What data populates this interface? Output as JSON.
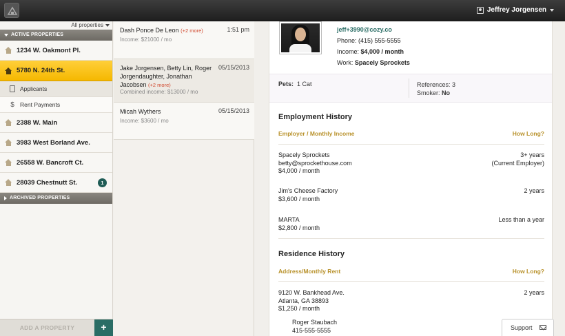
{
  "header": {
    "user_name": "Jeffrey Jorgensen"
  },
  "sidebar": {
    "filter_label": "All properties",
    "active_section": "ACTIVE PROPERTIES",
    "archived_section": "ARCHIVED PROPERTIES",
    "properties": [
      {
        "label": "1234 W. Oakmont Pl."
      },
      {
        "label": "5780 N. 24th St."
      },
      {
        "label": "2388 W. Main"
      },
      {
        "label": "3983 West Borland Ave."
      },
      {
        "label": "26558 W. Bancroft Ct."
      },
      {
        "label": "28039 Chestnutt St.",
        "badge": "1"
      }
    ],
    "subitems": [
      {
        "label": "Applicants"
      },
      {
        "label": "Rent Payments"
      }
    ],
    "add_property_label": "ADD A PROPERTY",
    "plus_label": "+"
  },
  "applicants": [
    {
      "name": "Dash Ponce De Leon",
      "more": "(+2 more)",
      "date": "1:51 pm",
      "income": "Income: $21000 / mo"
    },
    {
      "name": "Jake Jorgensen, Betty Lin, Roger Jorgendaughter, Jonathan Jacobsen",
      "more": "(+2 more)",
      "date": "05/15/2013",
      "income": "Combined income: $13000 / mo"
    },
    {
      "name": "Micah Wythers",
      "more": "",
      "date": "05/15/2013",
      "income": "Income: $3600 / mo"
    }
  ],
  "detail": {
    "email": "jeff+3990@cozy.co",
    "phone_label": "Phone:",
    "phone": "(415) 555-5555",
    "income_label": "Income:",
    "income": "$4,000 / month",
    "work_label": "Work:",
    "work": "Spacely Sprockets",
    "pets_label": "Pets:",
    "pets": "1 Cat",
    "references_label": "References:",
    "references": "3",
    "smoker_label": "Smoker:",
    "smoker": "No",
    "employment": {
      "title": "Employment History",
      "col_left": "Employer / Monthly Income",
      "col_right": "How Long?",
      "entries": [
        {
          "line1": "Spacely Sprockets",
          "line2": "betty@sprockethouse.com",
          "line3": "$4,000 / month",
          "right1": "3+ years",
          "right2": "(Current Employer)"
        },
        {
          "line1": "Jim's Cheese Factory",
          "line2": "$3,600 / month",
          "right1": "2 years"
        },
        {
          "line1": "MARTA",
          "line2": "$2,800 / month",
          "right1": "Less than a year"
        }
      ]
    },
    "residence": {
      "title": "Residence History",
      "col_left": "Address/Monthly Rent",
      "col_right": "How Long?",
      "entries": [
        {
          "line1": "9120 W. Bankhead Ave.",
          "line2": "Atlanta, GA 38893",
          "line3": "$1,250 / month",
          "right1": "2 years",
          "ref_name": "Roger Staubach",
          "ref_phone": "415-555-5555"
        }
      ]
    }
  },
  "support_label": "Support",
  "colors": {
    "accent_yellow": "#f5b800",
    "teal": "#2a6d65",
    "link_red": "#d0452a",
    "gold_header": "#b8912a"
  }
}
